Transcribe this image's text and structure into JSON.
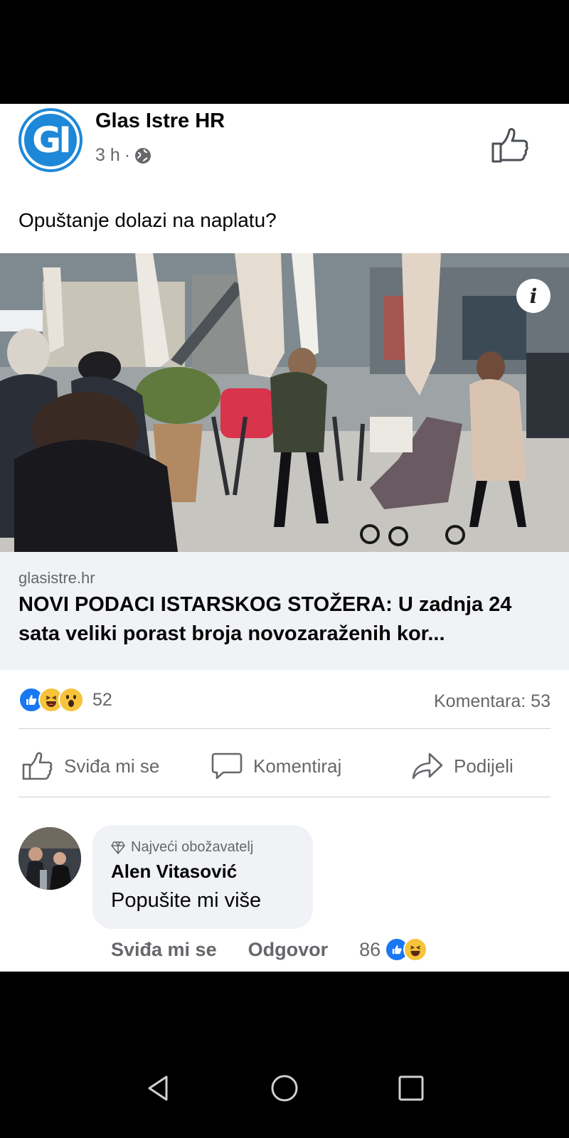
{
  "post": {
    "page_name": "Glas Istre HR",
    "page_logo_text": "GI",
    "time": "3 h",
    "separator": "·",
    "text": "Opuštanje dolazi na naplatu?",
    "info_label": "i"
  },
  "link": {
    "domain": "glasistre.hr",
    "headline": "NOVI PODACI ISTARSKOG STOŽERA: U zadnja 24 sata veliki porast broja novozaraženih kor..."
  },
  "stats": {
    "reactions": [
      "like-icon",
      "haha-icon",
      "wow-icon"
    ],
    "reaction_count": "52",
    "comments": "Komentara: 53"
  },
  "actions": {
    "like": "Sviđa mi se",
    "comment": "Komentiraj",
    "share": "Podijeli"
  },
  "comment": {
    "badge": "Najveći obožavatelj",
    "author": "Alen Vitasović",
    "text": "Popušite mi više",
    "like": "Sviđa mi se",
    "reply": "Odgovor",
    "reaction_count": "86",
    "reactions": [
      "like-icon",
      "haha-icon"
    ]
  },
  "colors": {
    "accent": "#1877f2",
    "secondary_text": "#65676b",
    "link_bg": "#f0f2f5"
  }
}
